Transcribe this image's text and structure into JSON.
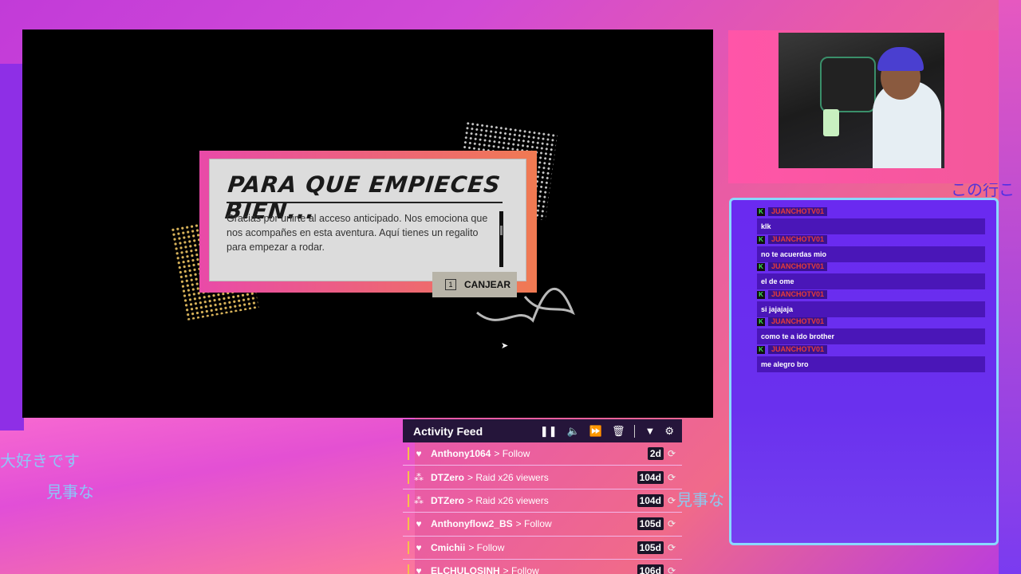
{
  "background": {
    "jp_text_1": "大好きです",
    "jp_text_2": "見事な",
    "jp_text_3": "見事な",
    "jp_text_4": "この行こ"
  },
  "game": {
    "dialog": {
      "title": "PARA QUE EMPIECES BIEN...",
      "body": "Gracias por unirte al acceso anticipado. Nos emociona que nos acompañes en esta aventura. Aquí tienes un regalito para empezar a rodar.",
      "redeem_key": "1",
      "redeem_label": "CANJEAR"
    }
  },
  "chat": {
    "messages": [
      {
        "user": "JUANCHOTV01",
        "text": "klk"
      },
      {
        "user": "JUANCHOTV01",
        "text": "no te acuerdas mio"
      },
      {
        "user": "JUANCHOTV01",
        "text": "el de ome"
      },
      {
        "user": "JUANCHOTV01",
        "text": "si jajajaja"
      },
      {
        "user": "JUANCHOTV01",
        "text": "como te a ido brother"
      },
      {
        "user": "JUANCHOTV01",
        "text": "me alegro bro"
      }
    ],
    "badge_letter": "K"
  },
  "activity_feed": {
    "title": "Activity Feed",
    "events": [
      {
        "icon": "heart-icon",
        "user": "Anthony1064",
        "action": "> Follow",
        "age": "2d"
      },
      {
        "icon": "raid-icon",
        "user": "DTZero",
        "action": "> Raid x26 viewers",
        "age": "104d"
      },
      {
        "icon": "raid-icon",
        "user": "DTZero",
        "action": "> Raid x26 viewers",
        "age": "104d"
      },
      {
        "icon": "heart-icon",
        "user": "Anthonyflow2_BS",
        "action": "> Follow",
        "age": "105d"
      },
      {
        "icon": "heart-icon",
        "user": "Cmichii",
        "action": "> Follow",
        "age": "105d"
      },
      {
        "icon": "heart-icon",
        "user": "ELCHULOSINH",
        "action": "> Follow",
        "age": "106d"
      }
    ]
  }
}
